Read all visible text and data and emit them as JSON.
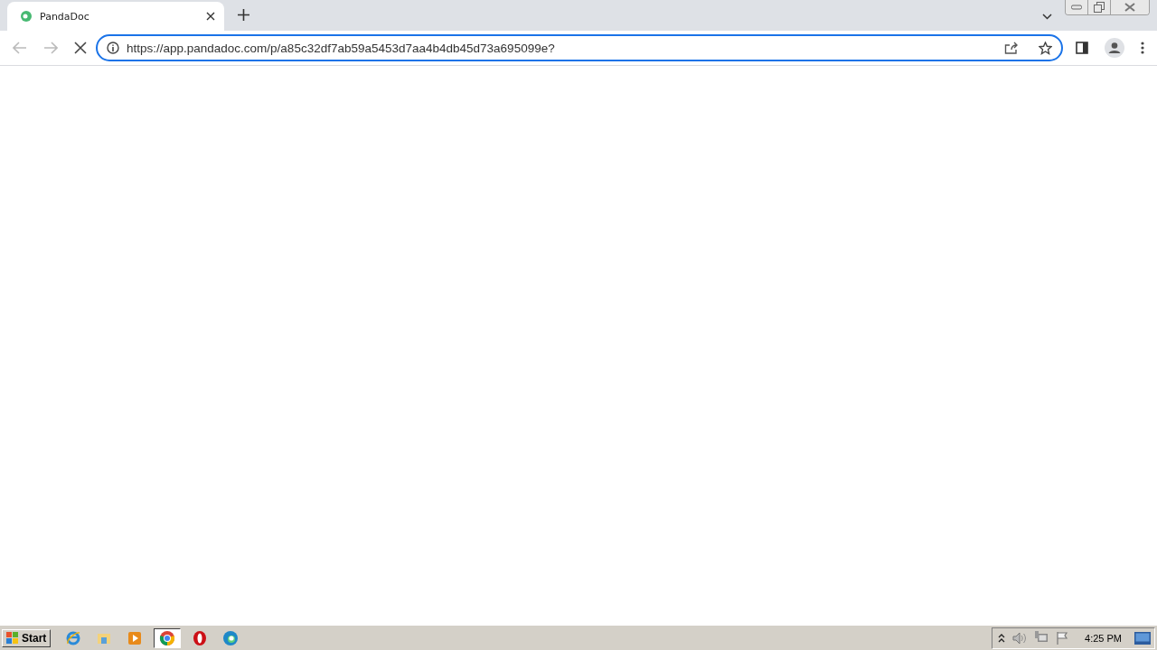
{
  "tabs": [
    {
      "title": "PandaDoc",
      "selected": true
    }
  ],
  "toolbar": {
    "loading": true,
    "url": "https://app.pandadoc.com/p/a85c32df7ab59a5453d7aa4b4db45d73a695099e?"
  },
  "taskbar": {
    "start_label": "Start",
    "apps": [
      {
        "kind": "ie",
        "active": false
      },
      {
        "kind": "folder",
        "active": false
      },
      {
        "kind": "media",
        "active": false
      },
      {
        "kind": "chrome",
        "active": true
      },
      {
        "kind": "opera",
        "active": false
      },
      {
        "kind": "edge",
        "active": false
      }
    ],
    "clock": "4:25 PM"
  }
}
